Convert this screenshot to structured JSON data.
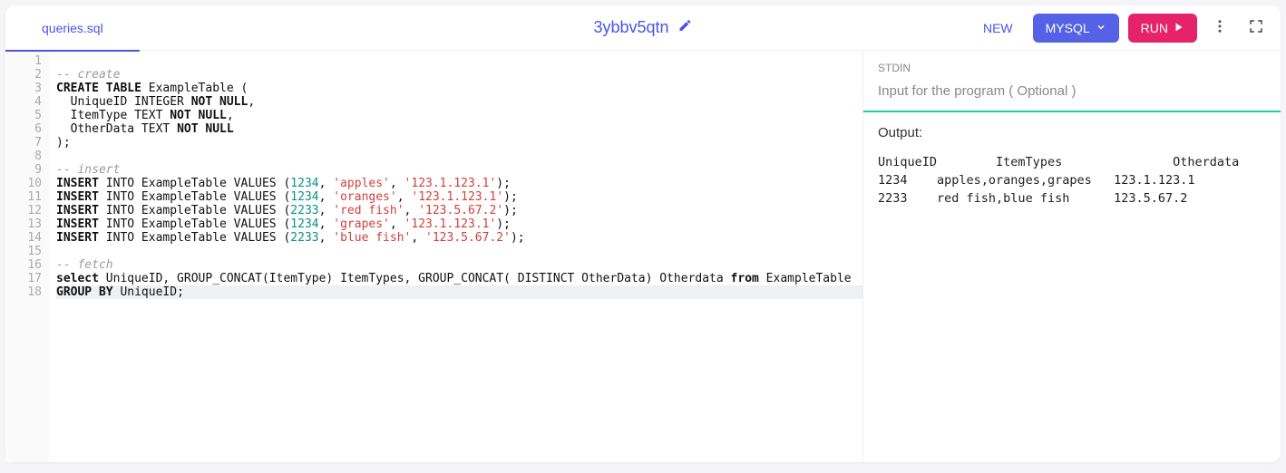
{
  "tab": {
    "filename": "queries.sql"
  },
  "title": "3ybbv5qtn",
  "toolbar": {
    "new_label": "NEW",
    "lang_label": "MYSQL",
    "run_label": "RUN"
  },
  "editor": {
    "line_count": 18,
    "active_line": 18,
    "lines": [
      {
        "n": 1,
        "segs": []
      },
      {
        "n": 2,
        "segs": [
          {
            "t": "-- create",
            "c": "cmt"
          }
        ]
      },
      {
        "n": 3,
        "segs": [
          {
            "t": "CREATE",
            "c": "kw"
          },
          {
            "t": " "
          },
          {
            "t": "TABLE",
            "c": "kw"
          },
          {
            "t": " ExampleTable ("
          }
        ]
      },
      {
        "n": 4,
        "segs": [
          {
            "t": "  UniqueID INTEGER "
          },
          {
            "t": "NOT",
            "c": "kw"
          },
          {
            "t": " "
          },
          {
            "t": "NULL",
            "c": "kw"
          },
          {
            "t": ","
          }
        ]
      },
      {
        "n": 5,
        "segs": [
          {
            "t": "  ItemType TEXT "
          },
          {
            "t": "NOT",
            "c": "kw"
          },
          {
            "t": " "
          },
          {
            "t": "NULL",
            "c": "kw"
          },
          {
            "t": ","
          }
        ]
      },
      {
        "n": 6,
        "segs": [
          {
            "t": "  OtherData TEXT "
          },
          {
            "t": "NOT",
            "c": "kw"
          },
          {
            "t": " "
          },
          {
            "t": "NULL",
            "c": "kw"
          }
        ]
      },
      {
        "n": 7,
        "segs": [
          {
            "t": ");"
          }
        ]
      },
      {
        "n": 8,
        "segs": []
      },
      {
        "n": 9,
        "segs": [
          {
            "t": "-- insert",
            "c": "cmt"
          }
        ]
      },
      {
        "n": 10,
        "segs": [
          {
            "t": "INSERT",
            "c": "kw"
          },
          {
            "t": " INTO ExampleTable VALUES ("
          },
          {
            "t": "1234",
            "c": "num"
          },
          {
            "t": ", "
          },
          {
            "t": "'apples'",
            "c": "str"
          },
          {
            "t": ", "
          },
          {
            "t": "'123.1.123.1'",
            "c": "str"
          },
          {
            "t": ");"
          }
        ]
      },
      {
        "n": 11,
        "segs": [
          {
            "t": "INSERT",
            "c": "kw"
          },
          {
            "t": " INTO ExampleTable VALUES ("
          },
          {
            "t": "1234",
            "c": "num"
          },
          {
            "t": ", "
          },
          {
            "t": "'oranges'",
            "c": "str"
          },
          {
            "t": ", "
          },
          {
            "t": "'123.1.123.1'",
            "c": "str"
          },
          {
            "t": ");"
          }
        ]
      },
      {
        "n": 12,
        "segs": [
          {
            "t": "INSERT",
            "c": "kw"
          },
          {
            "t": " INTO ExampleTable VALUES ("
          },
          {
            "t": "2233",
            "c": "num"
          },
          {
            "t": ", "
          },
          {
            "t": "'red fish'",
            "c": "str"
          },
          {
            "t": ", "
          },
          {
            "t": "'123.5.67.2'",
            "c": "str"
          },
          {
            "t": ");"
          }
        ]
      },
      {
        "n": 13,
        "segs": [
          {
            "t": "INSERT",
            "c": "kw"
          },
          {
            "t": " INTO ExampleTable VALUES ("
          },
          {
            "t": "1234",
            "c": "num"
          },
          {
            "t": ", "
          },
          {
            "t": "'grapes'",
            "c": "str"
          },
          {
            "t": ", "
          },
          {
            "t": "'123.1.123.1'",
            "c": "str"
          },
          {
            "t": ");"
          }
        ]
      },
      {
        "n": 14,
        "segs": [
          {
            "t": "INSERT",
            "c": "kw"
          },
          {
            "t": " INTO ExampleTable VALUES ("
          },
          {
            "t": "2233",
            "c": "num"
          },
          {
            "t": ", "
          },
          {
            "t": "'blue fish'",
            "c": "str"
          },
          {
            "t": ", "
          },
          {
            "t": "'123.5.67.2'",
            "c": "str"
          },
          {
            "t": ");"
          }
        ]
      },
      {
        "n": 15,
        "segs": []
      },
      {
        "n": 16,
        "segs": [
          {
            "t": "-- fetch",
            "c": "cmt"
          }
        ]
      },
      {
        "n": 17,
        "segs": [
          {
            "t": "select",
            "c": "kw"
          },
          {
            "t": " UniqueID, GROUP_CONCAT(ItemType) ItemTypes, GROUP_CONCAT( DISTINCT OtherData) Otherdata "
          },
          {
            "t": "from",
            "c": "kw"
          },
          {
            "t": " ExampleTable"
          }
        ]
      },
      {
        "n": 18,
        "segs": [
          {
            "t": "GROUP",
            "c": "kw"
          },
          {
            "t": " "
          },
          {
            "t": "BY",
            "c": "kw"
          },
          {
            "t": " UniqueID;"
          }
        ]
      }
    ]
  },
  "stdin": {
    "label": "STDIN",
    "placeholder": "Input for the program ( Optional )"
  },
  "output": {
    "label": "Output:",
    "text": "UniqueID\tItemTypes\t\tOtherdata\n1234\tapples,oranges,grapes\t123.1.123.1\n2233\tred fish,blue fish\t123.5.67.2"
  }
}
